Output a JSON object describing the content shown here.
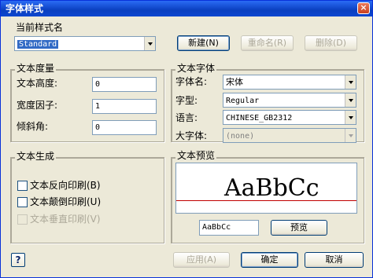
{
  "window": {
    "title": "字体样式",
    "close_glyph": "×"
  },
  "current_style": {
    "label": "当前样式名",
    "value": "Standard",
    "new_button": "新建(N)",
    "rename_button": "重命名(R)",
    "delete_button": "删除(D)"
  },
  "text_measure": {
    "title": "文本度量",
    "height_label": "文本高度:",
    "height_value": "0",
    "width_label": "宽度因子:",
    "width_value": "1",
    "oblique_label": "倾斜角:",
    "oblique_value": "0"
  },
  "text_font": {
    "title": "文本字体",
    "font_name_label": "字体名:",
    "font_name_value": "宋体",
    "style_label": "字型:",
    "style_value": "Regular",
    "language_label": "语言:",
    "language_value": "CHINESE_GB2312",
    "bigfont_label": "大字体:",
    "bigfont_value": "(none)"
  },
  "text_generation": {
    "title": "文本生成",
    "backwards_label": "文本反向印刷(B)",
    "upside_down_label": "文本颠倒印刷(U)",
    "vertical_label": "文本垂直印刷(V)"
  },
  "text_preview": {
    "title": "文本预览",
    "sample": "AaBbCc",
    "input_value": "AaBbCc",
    "preview_button": "预览"
  },
  "footer": {
    "help_glyph": "?",
    "apply_button": "应用(A)",
    "ok_button": "确定",
    "cancel_button": "取消"
  },
  "colors": {
    "titlebar": "#0a3fc0",
    "selection": "#316ac5",
    "baseline": "#c00000"
  }
}
